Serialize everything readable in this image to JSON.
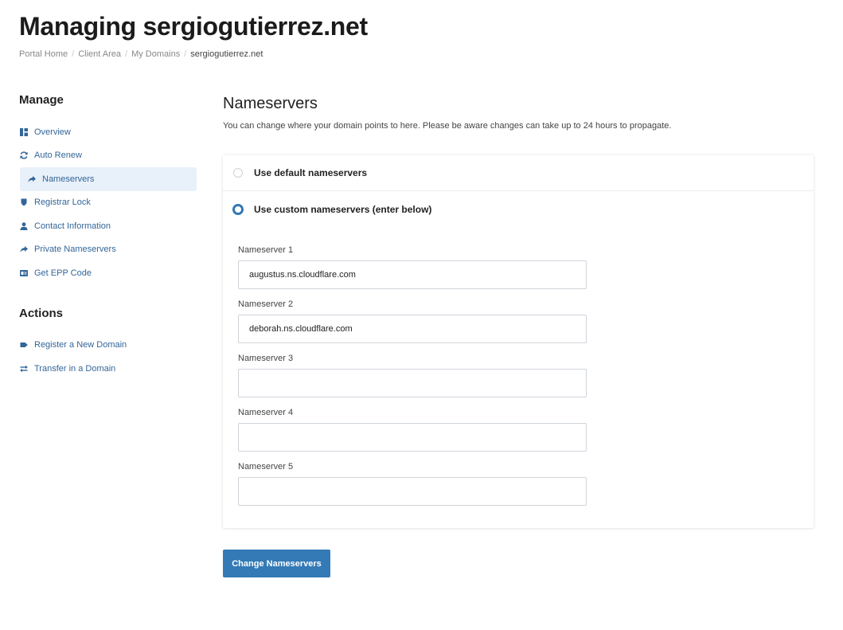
{
  "page": {
    "title": "Managing sergiogutierrez.net"
  },
  "breadcrumb": {
    "items": [
      "Portal Home",
      "Client Area",
      "My Domains"
    ],
    "current": "sergiogutierrez.net",
    "separator": "/"
  },
  "sidebar": {
    "manage_heading": "Manage",
    "manage_items": [
      {
        "label": "Overview",
        "icon": "dashboard-icon"
      },
      {
        "label": "Auto Renew",
        "icon": "sync-icon"
      },
      {
        "label": "Nameservers",
        "icon": "share-arrow-icon",
        "active": true
      },
      {
        "label": "Registrar Lock",
        "icon": "shield-icon"
      },
      {
        "label": "Contact Information",
        "icon": "user-icon"
      },
      {
        "label": "Private Nameservers",
        "icon": "share-arrow-icon"
      },
      {
        "label": "Get EPP Code",
        "icon": "id-card-icon"
      }
    ],
    "actions_heading": "Actions",
    "action_items": [
      {
        "label": "Register a New Domain",
        "icon": "tag-icon"
      },
      {
        "label": "Transfer in a Domain",
        "icon": "exchange-icon"
      }
    ]
  },
  "main": {
    "heading": "Nameservers",
    "description": "You can change where your domain points to here. Please be aware changes can take up to 24 hours to propagate.",
    "options": {
      "default_label": "Use default nameservers",
      "custom_label": "Use custom nameservers (enter below)",
      "selected": "custom"
    },
    "nameservers": [
      {
        "label": "Nameserver 1",
        "value": "augustus.ns.cloudflare.com"
      },
      {
        "label": "Nameserver 2",
        "value": "deborah.ns.cloudflare.com"
      },
      {
        "label": "Nameserver 3",
        "value": ""
      },
      {
        "label": "Nameserver 4",
        "value": ""
      },
      {
        "label": "Nameserver 5",
        "value": ""
      }
    ],
    "submit_label": "Change Nameservers"
  },
  "colors": {
    "link": "#336699",
    "primary_button": "#337ab7",
    "active_nav_bg": "#e8f0fa"
  }
}
